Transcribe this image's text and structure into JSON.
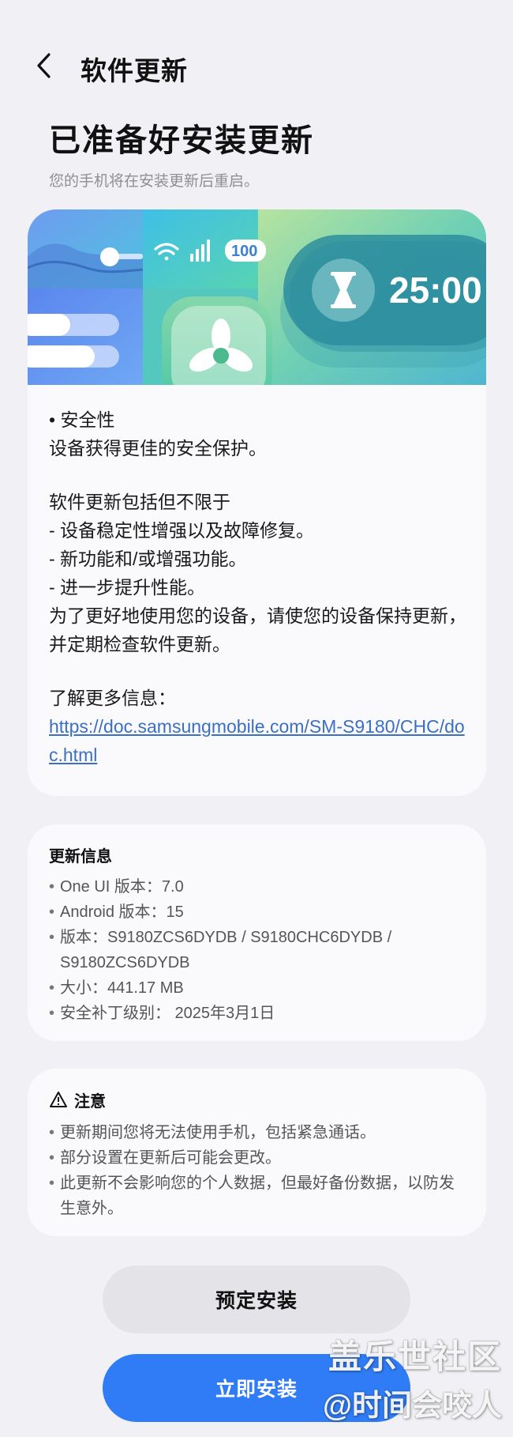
{
  "header": {
    "title": "软件更新",
    "back_icon": "chevron-left-icon"
  },
  "headline": "已准备好安装更新",
  "subline": "您的手机将在安装更新后重启。",
  "banner": {
    "timer_text": "25:00",
    "battery_text": "100",
    "icons": [
      "wifi-icon",
      "signal-icon",
      "battery-icon",
      "hourglass-icon",
      "fan-icon"
    ]
  },
  "notes": {
    "security_title": "• 安全性",
    "security_desc": "设备获得更佳的安全保护。",
    "includes_title": "软件更新包括但不限于",
    "items": [
      "- 设备稳定性增强以及故障修复。",
      "- 新功能和/或增强功能。",
      "- 进一步提升性能。"
    ],
    "advice": "为了更好地使用您的设备，请使您的设备保持更新，并定期检查软件更新。",
    "more_label": "了解更多信息：",
    "more_link": "https://doc.samsungmobile.com/SM-S9180/CHC/doc.html"
  },
  "update_info": {
    "title": "更新信息",
    "items": [
      "One UI 版本：7.0",
      "Android 版本：15",
      "版本：S9180ZCS6DYDB / S9180CHC6DYDB / S9180ZCS6DYDB",
      "大小：441.17 MB",
      "安全补丁级别： 2025年3月1日"
    ]
  },
  "notice": {
    "title": "注意",
    "icon": "warning-icon",
    "items": [
      "更新期间您将无法使用手机，包括紧急通话。",
      "部分设置在更新后可能会更改。",
      "此更新不会影响您的个人数据，但最好备份数据，以防发生意外。"
    ]
  },
  "buttons": {
    "schedule": "预定安装",
    "install": "立即安装"
  },
  "watermark": {
    "line1": "盖乐世社区",
    "line2": "@时间会咬人"
  },
  "colors": {
    "background": "#f1f1f5",
    "card": "#fafafd",
    "link": "#3a6fc4",
    "primary_button": "#2f7cf6",
    "secondary_button": "#e4e4e8"
  }
}
